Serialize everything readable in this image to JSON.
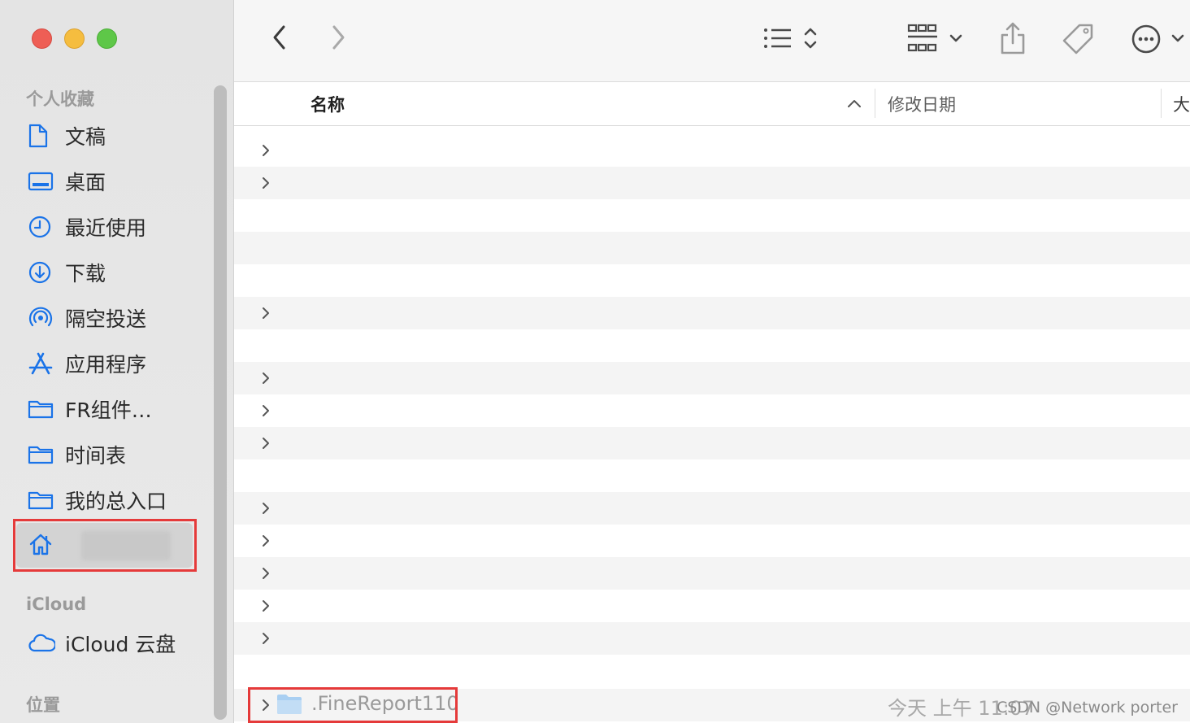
{
  "sidebar": {
    "favorites_heading": "个人收藏",
    "items": [
      {
        "label": "文稿",
        "icon": "document-icon"
      },
      {
        "label": "桌面",
        "icon": "desktop-icon"
      },
      {
        "label": "最近使用",
        "icon": "clock-icon"
      },
      {
        "label": "下载",
        "icon": "download-icon"
      },
      {
        "label": "隔空投送",
        "icon": "airdrop-icon"
      },
      {
        "label": "应用程序",
        "icon": "applications-icon"
      },
      {
        "label": "FR组件…",
        "icon": "folder-icon"
      },
      {
        "label": "时间表",
        "icon": "folder-icon"
      },
      {
        "label": "我的总入口",
        "icon": "folder-icon"
      }
    ],
    "home_icon": "home-icon",
    "icloud_heading": "iCloud",
    "icloud_item": {
      "label": "iCloud 云盘",
      "icon": "cloud-icon"
    },
    "locations_heading": "位置"
  },
  "header": {
    "name": "名称",
    "date_modified": "修改日期",
    "size": "大"
  },
  "file": {
    "name": ".FineReport110",
    "date": "今天 上午 11:07"
  },
  "watermark": "CSDN @Network porter",
  "colors": {
    "accent": "#1a73e8",
    "highlight": "#e53a3a"
  }
}
